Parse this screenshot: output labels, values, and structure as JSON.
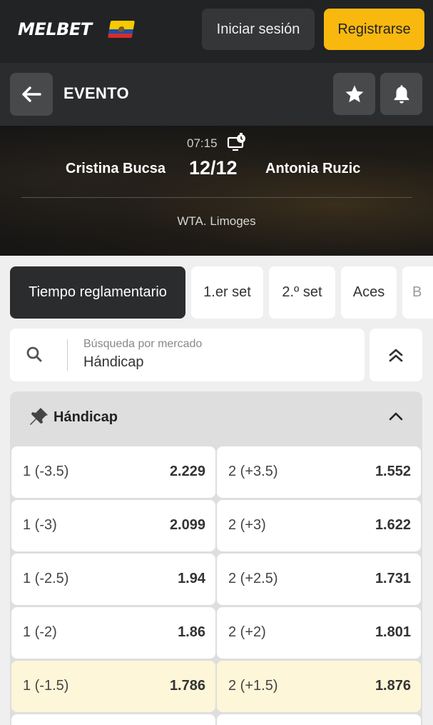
{
  "header": {
    "logo_text": "MELBET",
    "login_label": "Iniciar sesión",
    "register_label": "Registrarse",
    "accent_color": "#f9b80e"
  },
  "event_bar": {
    "title": "EVENTO"
  },
  "scoreboard": {
    "time": "07:15",
    "player1": "Cristina Bucsa",
    "score": "12/12",
    "player2": "Antonia Ruzic",
    "league": "WTA. Limoges"
  },
  "tabs": [
    {
      "label": "Tiempo reglamentario",
      "active": true
    },
    {
      "label": "1.er set",
      "active": false
    },
    {
      "label": "2.º set",
      "active": false
    },
    {
      "label": "Aces",
      "active": false
    },
    {
      "label": "B",
      "active": false
    }
  ],
  "search": {
    "placeholder": "Búsqueda por mercado",
    "value": "Hándicap"
  },
  "market": {
    "title": "Hándicap",
    "rows": [
      {
        "left_label": "1 (-3.5)",
        "left_odd": "2.229",
        "right_label": "2 (+3.5)",
        "right_odd": "1.552"
      },
      {
        "left_label": "1 (-3)",
        "left_odd": "2.099",
        "right_label": "2 (+3)",
        "right_odd": "1.622"
      },
      {
        "left_label": "1 (-2.5)",
        "left_odd": "1.94",
        "right_label": "2 (+2.5)",
        "right_odd": "1.731"
      },
      {
        "left_label": "1 (-2)",
        "left_odd": "1.86",
        "right_label": "2 (+2)",
        "right_odd": "1.801"
      },
      {
        "left_label": "1 (-1.5)",
        "left_odd": "1.786",
        "right_label": "2 (+1.5)",
        "right_odd": "1.876"
      }
    ]
  }
}
